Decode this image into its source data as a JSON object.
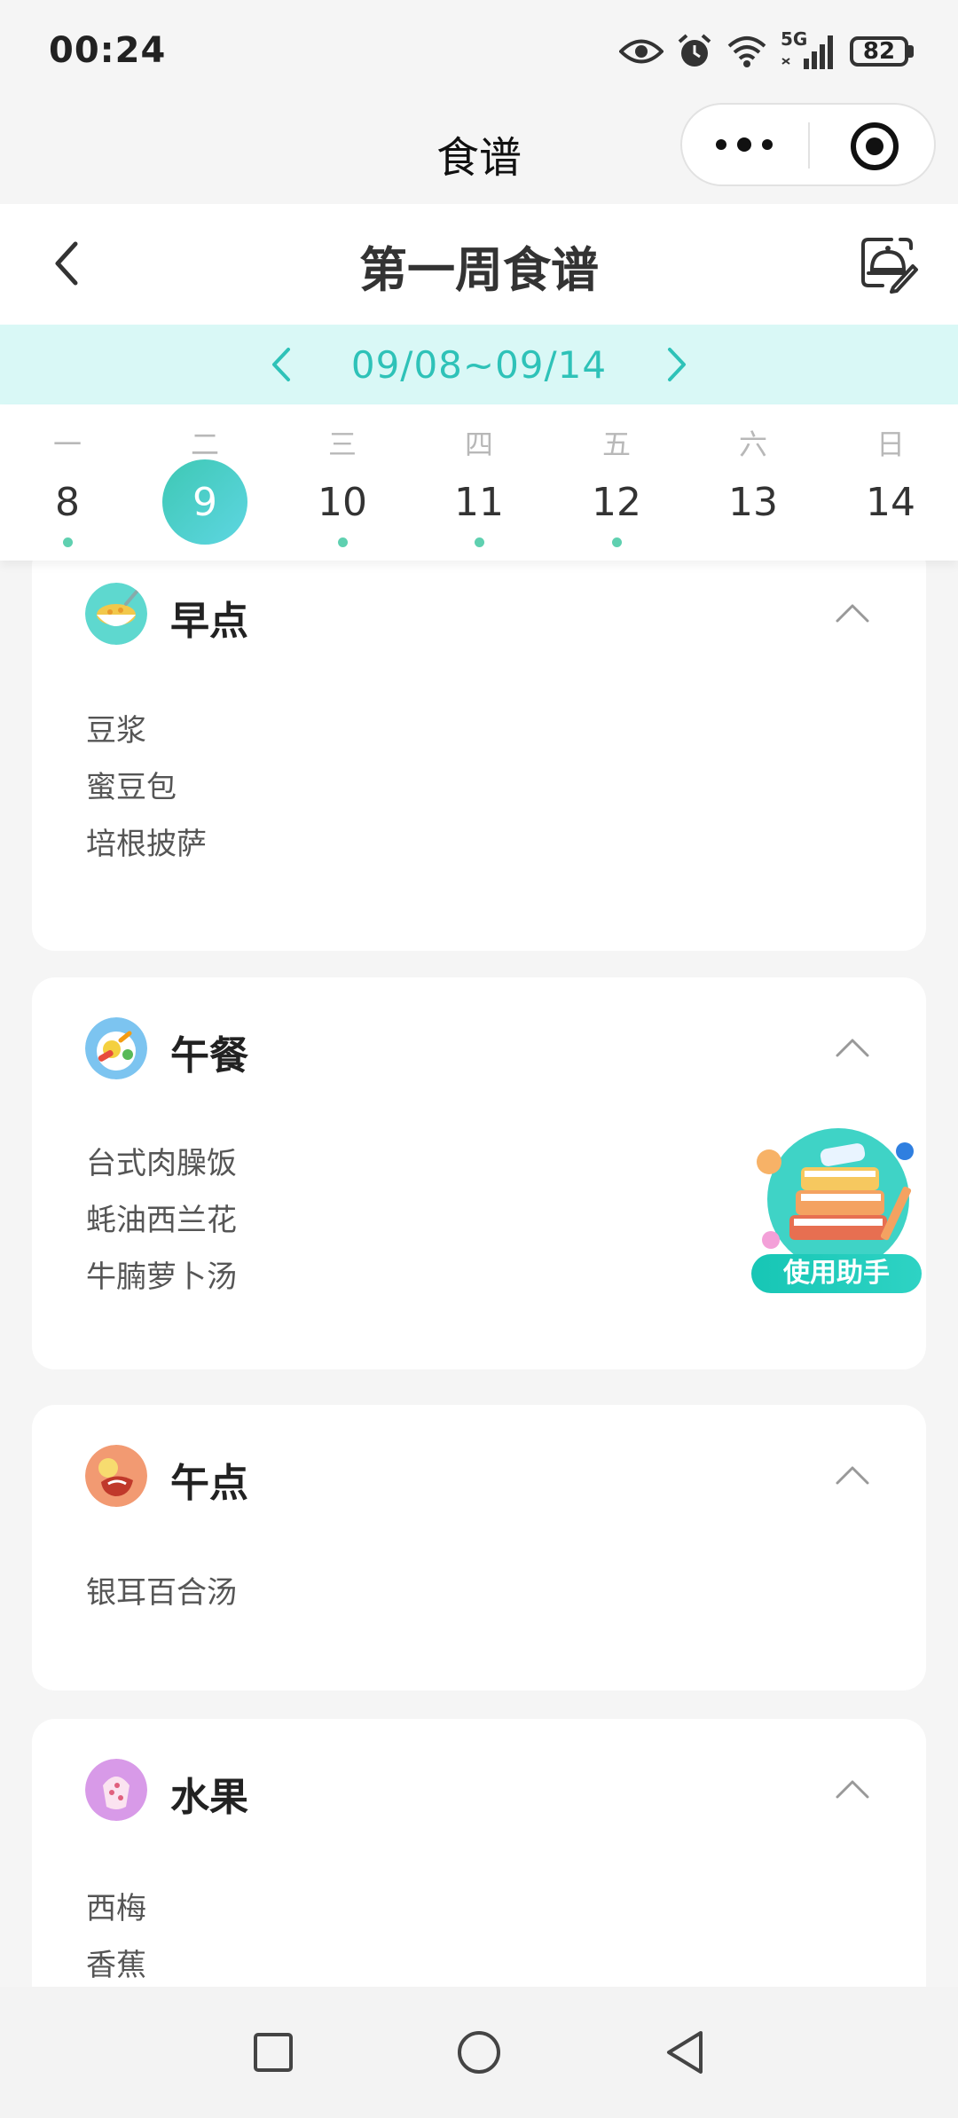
{
  "status_bar": {
    "time": "00:24",
    "network": "5G",
    "battery": "82",
    "icons": [
      "eye-icon",
      "alarm-icon",
      "wifi-icon",
      "signal-icon",
      "battery-icon"
    ]
  },
  "mini_program": {
    "title": "食谱",
    "icons": [
      "more-icon",
      "close-target-icon"
    ]
  },
  "header": {
    "title": "第一周食谱",
    "icons": [
      "back-icon",
      "menu-edit-icon"
    ]
  },
  "week": {
    "range": "09/08~09/14"
  },
  "days": [
    {
      "weekday": "一",
      "date": "8",
      "has_menu": true,
      "selected": false
    },
    {
      "weekday": "二",
      "date": "9",
      "has_menu": false,
      "selected": true
    },
    {
      "weekday": "三",
      "date": "10",
      "has_menu": true,
      "selected": false
    },
    {
      "weekday": "四",
      "date": "11",
      "has_menu": true,
      "selected": false
    },
    {
      "weekday": "五",
      "date": "12",
      "has_menu": true,
      "selected": false
    },
    {
      "weekday": "六",
      "date": "13",
      "has_menu": false,
      "selected": false
    },
    {
      "weekday": "日",
      "date": "14",
      "has_menu": false,
      "selected": false
    }
  ],
  "meals": [
    {
      "title": "早点",
      "icon": "soup-bowl-icon",
      "items": [
        "豆浆",
        "蜜豆包",
        "培根披萨"
      ]
    },
    {
      "title": "午餐",
      "icon": "plate-icon",
      "items": [
        "台式肉臊饭",
        "蚝油西兰花",
        "牛腩萝卜汤"
      ]
    },
    {
      "title": "午点",
      "icon": "snack-icon",
      "items": [
        "银耳百合汤"
      ]
    },
    {
      "title": "水果",
      "icon": "fruit-icon",
      "items": [
        "西梅",
        "香蕉"
      ]
    }
  ],
  "assistant": {
    "label": "使用助手"
  },
  "colors": {
    "accent": "#2ec2b8",
    "week_bar_bg": "#d9f8f6",
    "dot": "#5fd0b0"
  }
}
